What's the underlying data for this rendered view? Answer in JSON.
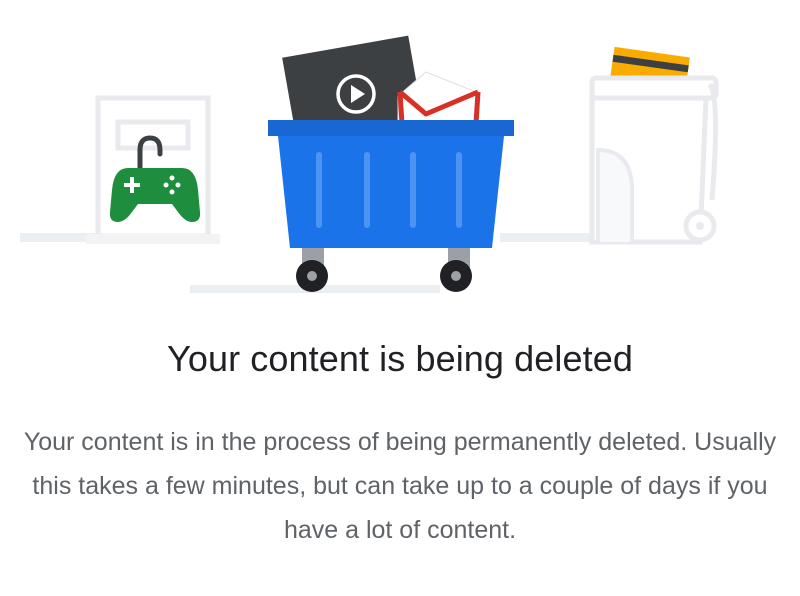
{
  "heading": "Your content is being deleted",
  "description": "Your content is in the process of being permanently deleted. Usually this takes a few minutes, but can take up to a couple of days if you have a lot of content.",
  "colors": {
    "dumpster_blue": "#1a73e8",
    "gamepad_green": "#1e8e3e",
    "mail_red": "#d93025",
    "card_yellow": "#f9ab00",
    "title_text": "#202124",
    "body_text": "#5f6368"
  },
  "icons": [
    "dumpster-icon",
    "video-icon",
    "mail-icon",
    "gamepad-icon",
    "lock-icon",
    "credit-card-icon",
    "trash-can-icon"
  ]
}
